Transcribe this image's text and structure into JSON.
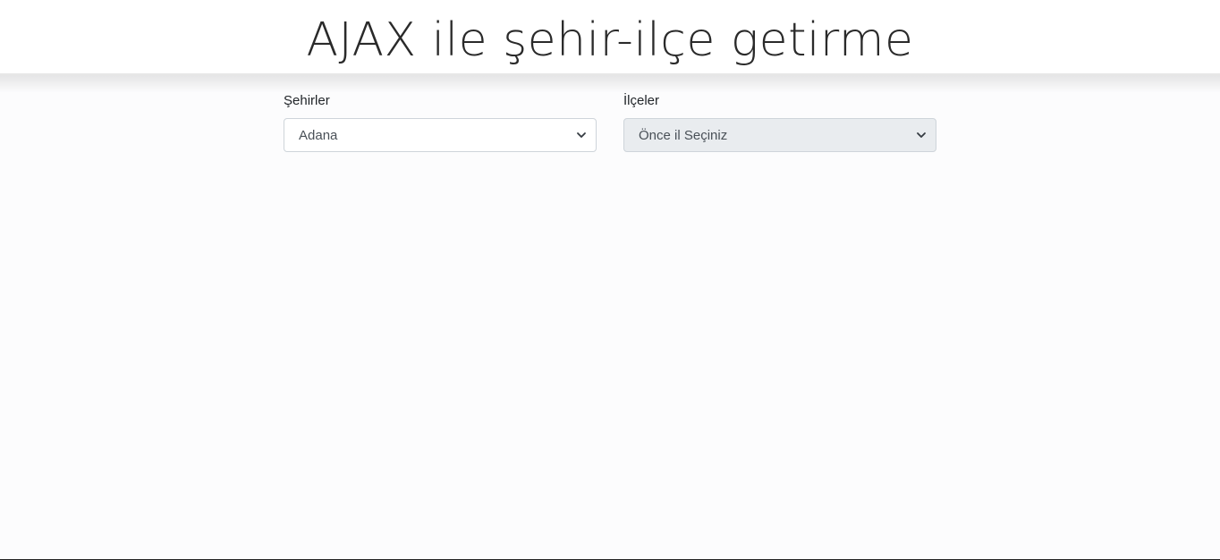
{
  "header": {
    "title": "AJAX ile şehir-ilçe getirme"
  },
  "form": {
    "cities": {
      "label": "Şehirler",
      "selected": "Adana",
      "icon": "chevron-down-icon"
    },
    "districts": {
      "label": "İlçeler",
      "selected": "Önce il Seçiniz",
      "disabled": true,
      "icon": "chevron-down-icon"
    }
  },
  "colors": {
    "background": "#fcfcfd",
    "select_border": "#ced4da",
    "disabled_bg": "#e9ecef",
    "text": "#495057"
  }
}
